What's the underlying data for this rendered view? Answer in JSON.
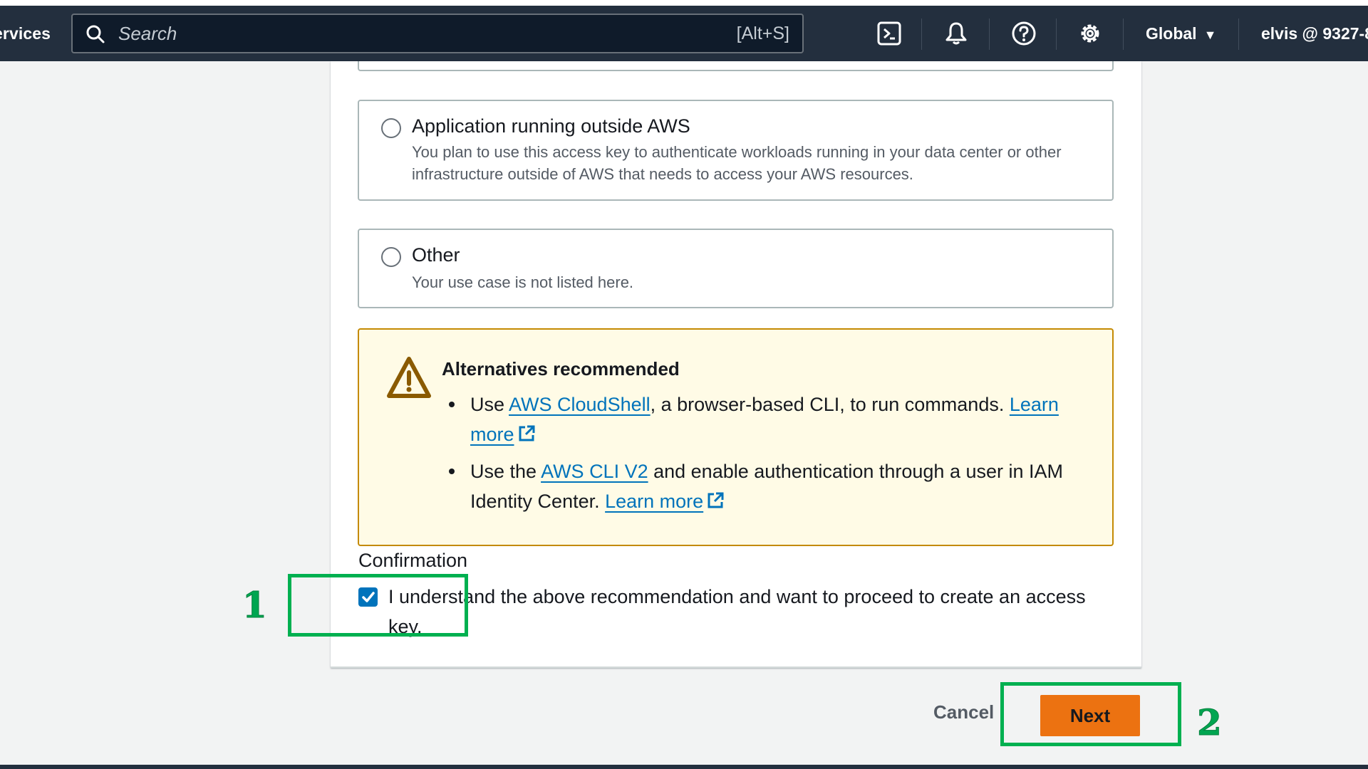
{
  "nav": {
    "services_label": "ervices",
    "search_placeholder": "Search",
    "search_shortcut": "[Alt+S]",
    "region_label": "Global",
    "account_label": "elvis @ 9327-8",
    "icons": [
      "cloudshell-icon",
      "bell-icon",
      "help-icon",
      "settings-icon"
    ]
  },
  "options": [
    {
      "title": "Application running outside AWS",
      "description": "You plan to use this access key to authenticate workloads running in your data center or other infrastructure outside of AWS that needs to access your AWS resources.",
      "selected": false
    },
    {
      "title": "Other",
      "description": "Your use case is not listed here.",
      "selected": false
    }
  ],
  "alert": {
    "title": "Alternatives recommended",
    "item1": {
      "prefix": "Use ",
      "link": "AWS CloudShell",
      "middle": ", a browser-based CLI, to run commands. ",
      "learn_more": "Learn more"
    },
    "item2": {
      "prefix": "Use the ",
      "link": "AWS CLI V2",
      "middle": " and enable authentication through a user in IAM Identity Center. ",
      "learn_more": "Learn more"
    },
    "color": "#c48a04"
  },
  "confirmation": {
    "label": "Confirmation",
    "checkbox_text": "I understand the above recommendation and want to proceed to create an access key.",
    "checked": true
  },
  "actions": {
    "cancel_label": "Cancel",
    "next_label": "Next",
    "primary_color": "#ec7211"
  },
  "annotations": {
    "step1": "1",
    "step2": "2",
    "color": "#00b050"
  }
}
